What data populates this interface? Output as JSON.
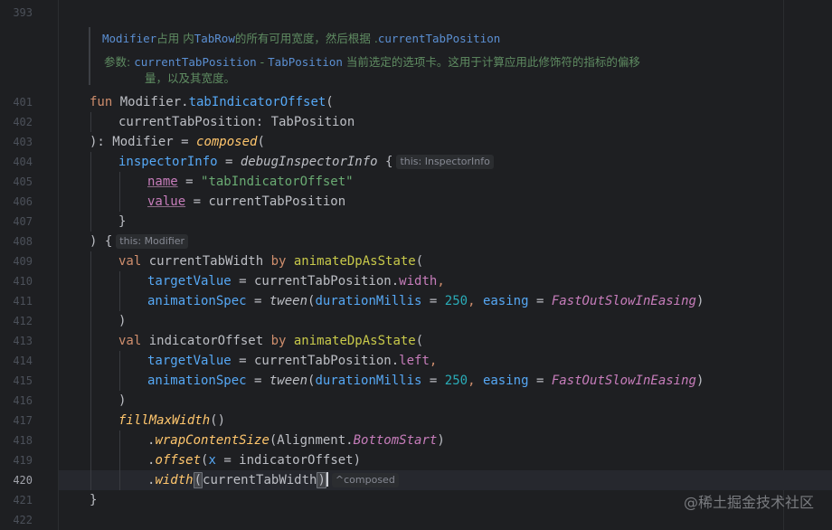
{
  "editor": {
    "current_line": "420",
    "doc": {
      "line1_code": "Modifier",
      "line1_a": "占用 内",
      "line1_b": "TabRow",
      "line1_c": "的所有可用宽度，然后根据 .",
      "line1_d": "currentTabPosition",
      "param_label": "参数:",
      "param_name": "currentTabPosition",
      "param_dash": " - ",
      "param_type": "TabPosition",
      "param_desc": " 当前选定的选项卡。这用于计算应用此修饰符的指标的偏移",
      "param_desc2": "量，以及其宽度。"
    },
    "line_numbers": [
      "393",
      "401",
      "402",
      "403",
      "404",
      "405",
      "406",
      "407",
      "408",
      "409",
      "410",
      "411",
      "412",
      "413",
      "414",
      "415",
      "416",
      "417",
      "418",
      "419",
      "420",
      "421",
      "422"
    ],
    "code": {
      "l401_fun": "fun ",
      "l401_recv": "Modifier.",
      "l401_name": "tabIndicatorOffset",
      "l401_paren": "(",
      "l402": "currentTabPosition: TabPosition",
      "l403_a": "): Modifier = ",
      "l403_b": "composed",
      "l403_c": "(",
      "l404_a": "inspectorInfo",
      "l404_b": " = ",
      "l404_c": "debugInspectorInfo",
      "l404_d": " {",
      "l404_hint": "this: InspectorInfo",
      "l405_a": "name",
      "l405_b": " = ",
      "l405_c": "\"tabIndicatorOffset\"",
      "l406_a": "value",
      "l406_b": " = currentTabPosition",
      "l407": "}",
      "l408": ") {",
      "l408_hint": "this: Modifier",
      "l409_a": "val ",
      "l409_b": "currentTabWidth ",
      "l409_c": "by ",
      "l409_d": "animateDpAsState",
      "l409_e": "(",
      "l410_a": "targetValue",
      "l410_b": " = currentTabPosition.",
      "l410_c": "width",
      "l410_d": ",",
      "l411_a": "animationSpec",
      "l411_b": " = ",
      "l411_c": "tween",
      "l411_d": "(",
      "l411_e": "durationMillis",
      "l411_f": " = ",
      "l411_g": "250",
      "l411_h": ", ",
      "l411_i": "easing",
      "l411_j": " = ",
      "l411_k": "FastOutSlowInEasing",
      "l411_l": ")",
      "l412": ")",
      "l413_a": "val ",
      "l413_b": "indicatorOffset ",
      "l413_c": "by ",
      "l413_d": "animateDpAsState",
      "l413_e": "(",
      "l414_a": "targetValue",
      "l414_b": " = currentTabPosition.",
      "l414_c": "left",
      "l414_d": ",",
      "l415_a": "animationSpec",
      "l415_b": " = ",
      "l415_c": "tween",
      "l415_d": "(",
      "l415_e": "durationMillis",
      "l415_f": " = ",
      "l415_g": "250",
      "l415_h": ", ",
      "l415_i": "easing",
      "l415_j": " = ",
      "l415_k": "FastOutSlowInEasing",
      "l415_l": ")",
      "l416": ")",
      "l417_a": "fillMaxWidth",
      "l417_b": "()",
      "l418_a": ".",
      "l418_b": "wrapContentSize",
      "l418_c": "(Alignment.",
      "l418_d": "BottomStart",
      "l418_e": ")",
      "l419_a": ".",
      "l419_b": "offset",
      "l419_c": "(",
      "l419_d": "x",
      "l419_e": " = indicatorOffset)",
      "l420_a": ".",
      "l420_b": "width",
      "l420_c": "(",
      "l420_d": "currentTabWidth",
      "l420_e": ")",
      "l420_hint": "^composed",
      "l421": "}"
    },
    "watermark": "@稀土掘金技术社区"
  }
}
